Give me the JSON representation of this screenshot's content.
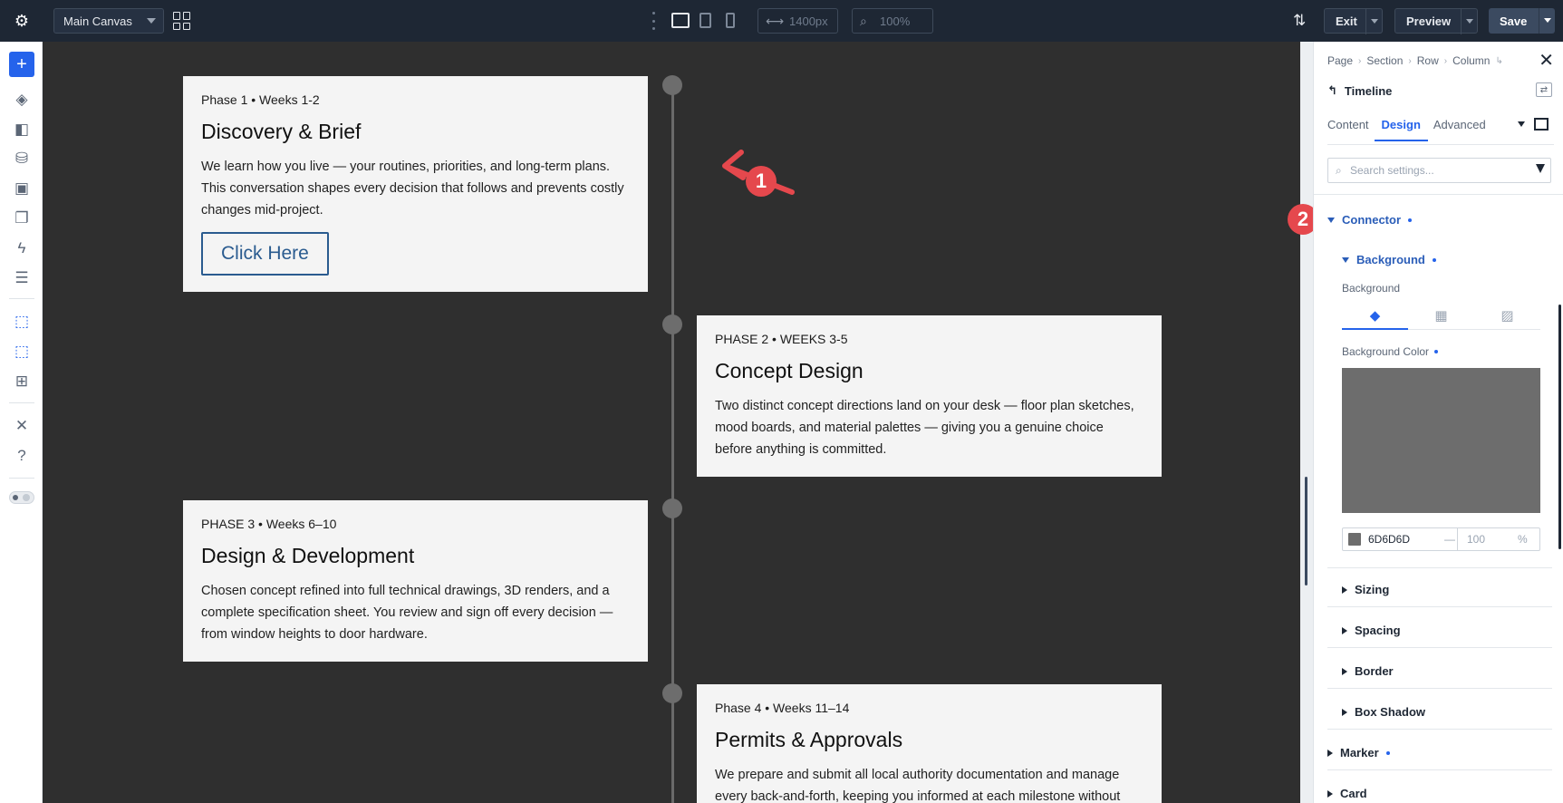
{
  "topbar": {
    "canvas_select": "Main Canvas",
    "width_value": "1400px",
    "zoom_value": "100%",
    "exit_label": "Exit",
    "preview_label": "Preview",
    "save_label": "Save"
  },
  "timeline": {
    "cards": [
      {
        "phase": "Phase 1 • Weeks 1-2",
        "title": "Discovery & Brief",
        "body": "We learn how you live — your routines, priorities, and long-term plans. This conversation shapes every decision that follows and prevents costly changes mid-project.",
        "button": "Click Here"
      },
      {
        "phase": "PHASE 2 • WEEKS 3-5",
        "title": "Concept Design",
        "body": "Two distinct concept directions land on your desk — floor plan sketches, mood boards, and material palettes — giving you a genuine choice before anything is committed."
      },
      {
        "phase": "PHASE 3 • Weeks 6–10",
        "title": "Design & Development",
        "body": "Chosen concept refined into full technical drawings, 3D renders, and a complete specification sheet. You review and sign off every decision — from window heights to door hardware."
      },
      {
        "phase": "Phase 4 • Weeks 11–14",
        "title": "Permits & Approvals",
        "body": "We prepare and submit all local authority documentation and manage every back-and-forth, keeping you informed at each milestone without"
      }
    ],
    "annotation_1": "1",
    "annotation_2": "2"
  },
  "panel": {
    "breadcrumbs": [
      "Page",
      "Section",
      "Row",
      "Column"
    ],
    "module_name": "Timeline",
    "tabs": [
      "Content",
      "Design",
      "Advanced"
    ],
    "active_tab": "Design",
    "search_placeholder": "Search settings...",
    "connector_label": "Connector",
    "background_group_label": "Background",
    "background_label": "Background",
    "background_color_label": "Background Color",
    "color_hex": "6D6D6D",
    "color_dash": "—",
    "opacity_value": "100",
    "opacity_unit": "%",
    "groups": [
      "Sizing",
      "Spacing",
      "Border",
      "Box Shadow"
    ],
    "marker_label": "Marker",
    "card_label": "Card"
  },
  "colors": {
    "accent": "#2563eb",
    "connector": "#6D6D6D",
    "annotation": "#e5484d",
    "topbar": "#1e2734",
    "canvas": "#2f2f2f"
  }
}
